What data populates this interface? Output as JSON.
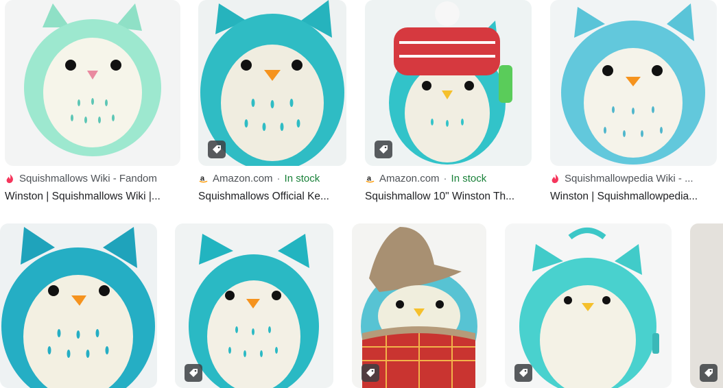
{
  "results": [
    {
      "source": "Squishmallows Wiki - Fandom",
      "favicon": "fandom-flame-icon",
      "title": "Winston | Squishmallows Wiki |...",
      "in_stock": "",
      "tag": false
    },
    {
      "source": "Amazon.com",
      "favicon": "amazon-icon",
      "title": "Squishmallows Official Ke...",
      "in_stock": "In stock",
      "tag": true
    },
    {
      "source": "Amazon.com",
      "favicon": "amazon-icon",
      "title": "Squishmallow 10\" Winston Th...",
      "in_stock": "In stock",
      "tag": true
    },
    {
      "source": "Squishmallowpedia Wiki - ...",
      "favicon": "fandom-flame-icon",
      "title": "Winston | Squishmallowpedia...",
      "in_stock": "",
      "tag": false
    }
  ],
  "separator": "·",
  "colors": {
    "in_stock": "#188038",
    "meta_text": "#4d5156",
    "title_text": "#202124"
  }
}
